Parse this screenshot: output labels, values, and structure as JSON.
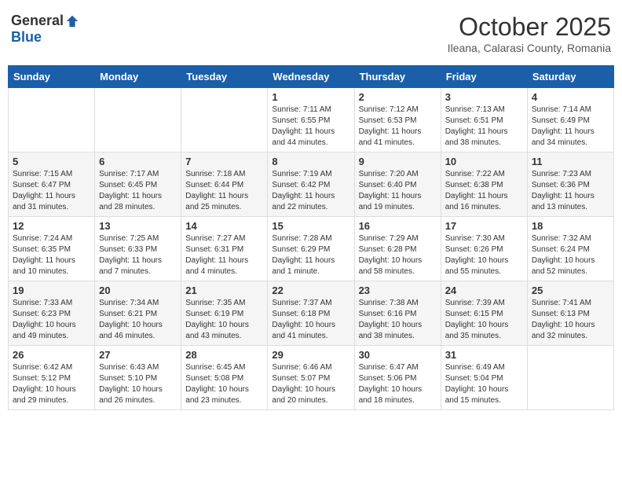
{
  "logo": {
    "general": "General",
    "blue": "Blue"
  },
  "title": "October 2025",
  "subtitle": "Ileana, Calarasi County, Romania",
  "weekdays": [
    "Sunday",
    "Monday",
    "Tuesday",
    "Wednesday",
    "Thursday",
    "Friday",
    "Saturday"
  ],
  "weeks": [
    [
      {
        "day": "",
        "info": ""
      },
      {
        "day": "",
        "info": ""
      },
      {
        "day": "",
        "info": ""
      },
      {
        "day": "1",
        "info": "Sunrise: 7:11 AM\nSunset: 6:55 PM\nDaylight: 11 hours and 44 minutes."
      },
      {
        "day": "2",
        "info": "Sunrise: 7:12 AM\nSunset: 6:53 PM\nDaylight: 11 hours and 41 minutes."
      },
      {
        "day": "3",
        "info": "Sunrise: 7:13 AM\nSunset: 6:51 PM\nDaylight: 11 hours and 38 minutes."
      },
      {
        "day": "4",
        "info": "Sunrise: 7:14 AM\nSunset: 6:49 PM\nDaylight: 11 hours and 34 minutes."
      }
    ],
    [
      {
        "day": "5",
        "info": "Sunrise: 7:15 AM\nSunset: 6:47 PM\nDaylight: 11 hours and 31 minutes."
      },
      {
        "day": "6",
        "info": "Sunrise: 7:17 AM\nSunset: 6:45 PM\nDaylight: 11 hours and 28 minutes."
      },
      {
        "day": "7",
        "info": "Sunrise: 7:18 AM\nSunset: 6:44 PM\nDaylight: 11 hours and 25 minutes."
      },
      {
        "day": "8",
        "info": "Sunrise: 7:19 AM\nSunset: 6:42 PM\nDaylight: 11 hours and 22 minutes."
      },
      {
        "day": "9",
        "info": "Sunrise: 7:20 AM\nSunset: 6:40 PM\nDaylight: 11 hours and 19 minutes."
      },
      {
        "day": "10",
        "info": "Sunrise: 7:22 AM\nSunset: 6:38 PM\nDaylight: 11 hours and 16 minutes."
      },
      {
        "day": "11",
        "info": "Sunrise: 7:23 AM\nSunset: 6:36 PM\nDaylight: 11 hours and 13 minutes."
      }
    ],
    [
      {
        "day": "12",
        "info": "Sunrise: 7:24 AM\nSunset: 6:35 PM\nDaylight: 11 hours and 10 minutes."
      },
      {
        "day": "13",
        "info": "Sunrise: 7:25 AM\nSunset: 6:33 PM\nDaylight: 11 hours and 7 minutes."
      },
      {
        "day": "14",
        "info": "Sunrise: 7:27 AM\nSunset: 6:31 PM\nDaylight: 11 hours and 4 minutes."
      },
      {
        "day": "15",
        "info": "Sunrise: 7:28 AM\nSunset: 6:29 PM\nDaylight: 11 hours and 1 minute."
      },
      {
        "day": "16",
        "info": "Sunrise: 7:29 AM\nSunset: 6:28 PM\nDaylight: 10 hours and 58 minutes."
      },
      {
        "day": "17",
        "info": "Sunrise: 7:30 AM\nSunset: 6:26 PM\nDaylight: 10 hours and 55 minutes."
      },
      {
        "day": "18",
        "info": "Sunrise: 7:32 AM\nSunset: 6:24 PM\nDaylight: 10 hours and 52 minutes."
      }
    ],
    [
      {
        "day": "19",
        "info": "Sunrise: 7:33 AM\nSunset: 6:23 PM\nDaylight: 10 hours and 49 minutes."
      },
      {
        "day": "20",
        "info": "Sunrise: 7:34 AM\nSunset: 6:21 PM\nDaylight: 10 hours and 46 minutes."
      },
      {
        "day": "21",
        "info": "Sunrise: 7:35 AM\nSunset: 6:19 PM\nDaylight: 10 hours and 43 minutes."
      },
      {
        "day": "22",
        "info": "Sunrise: 7:37 AM\nSunset: 6:18 PM\nDaylight: 10 hours and 41 minutes."
      },
      {
        "day": "23",
        "info": "Sunrise: 7:38 AM\nSunset: 6:16 PM\nDaylight: 10 hours and 38 minutes."
      },
      {
        "day": "24",
        "info": "Sunrise: 7:39 AM\nSunset: 6:15 PM\nDaylight: 10 hours and 35 minutes."
      },
      {
        "day": "25",
        "info": "Sunrise: 7:41 AM\nSunset: 6:13 PM\nDaylight: 10 hours and 32 minutes."
      }
    ],
    [
      {
        "day": "26",
        "info": "Sunrise: 6:42 AM\nSunset: 5:12 PM\nDaylight: 10 hours and 29 minutes."
      },
      {
        "day": "27",
        "info": "Sunrise: 6:43 AM\nSunset: 5:10 PM\nDaylight: 10 hours and 26 minutes."
      },
      {
        "day": "28",
        "info": "Sunrise: 6:45 AM\nSunset: 5:08 PM\nDaylight: 10 hours and 23 minutes."
      },
      {
        "day": "29",
        "info": "Sunrise: 6:46 AM\nSunset: 5:07 PM\nDaylight: 10 hours and 20 minutes."
      },
      {
        "day": "30",
        "info": "Sunrise: 6:47 AM\nSunset: 5:06 PM\nDaylight: 10 hours and 18 minutes."
      },
      {
        "day": "31",
        "info": "Sunrise: 6:49 AM\nSunset: 5:04 PM\nDaylight: 10 hours and 15 minutes."
      },
      {
        "day": "",
        "info": ""
      }
    ]
  ]
}
